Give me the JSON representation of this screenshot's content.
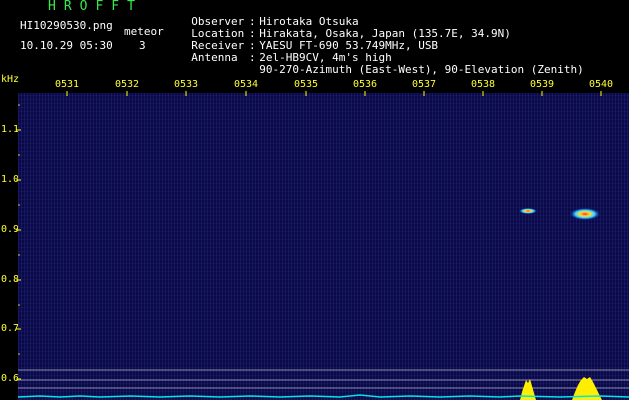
{
  "header": {
    "app_title": "HROFFT",
    "file_name": "HI10290530.png",
    "timestamp": "10.10.29 05:30",
    "meteor_label": "meteor",
    "meteor_count": "3"
  },
  "station": [
    {
      "key": "Observer",
      "value": "Hirotaka Otsuka"
    },
    {
      "key": "Location",
      "value": "Hirakata, Osaka, Japan (135.7E, 34.9N)"
    },
    {
      "key": "Receiver",
      "value": "YAESU FT-690 53.749MHz, USB"
    },
    {
      "key": "Antenna",
      "value": "2el-HB9CV, 4m's high"
    },
    {
      "key": "",
      "value": "90-270-Azimuth (East-West), 90-Elevation (Zenith)"
    }
  ],
  "separator": ":",
  "axis": {
    "unit_label": "kHz",
    "time_ticks": [
      "0531",
      "0532",
      "0533",
      "0534",
      "0535",
      "0536",
      "0537",
      "0538",
      "0539",
      "0540"
    ],
    "freq_ticks": [
      "1.1",
      "1.0",
      "0.9",
      "0.8",
      "0.7",
      "0.6"
    ]
  },
  "colors": {
    "title": "#39e84a",
    "tick_text": "#ffff33",
    "background": "#0a0a46",
    "marker": "#ffff00",
    "baseline": "#00e5e5",
    "hline": "#8a8aa8",
    "echo_core": "#ff3030"
  },
  "echoes": [
    {
      "time": "05:39",
      "freq_khz": 0.94
    },
    {
      "time": "05:40",
      "freq_khz": 0.935
    }
  ],
  "icons": {
    "spectrogram": "spectrogram-waterfall",
    "marker": "tick-mark"
  }
}
